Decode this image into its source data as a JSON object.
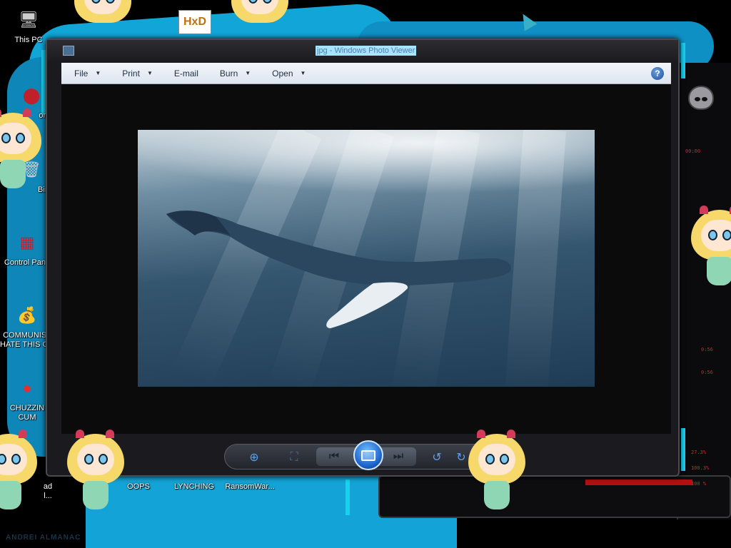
{
  "window": {
    "title": "jpg - Windows Photo Viewer",
    "menu": [
      {
        "label": "File",
        "has_caret": true
      },
      {
        "label": "Print",
        "has_caret": true
      },
      {
        "label": "E-mail",
        "has_caret": false
      },
      {
        "label": "Burn",
        "has_caret": true
      },
      {
        "label": "Open",
        "has_caret": true
      }
    ],
    "help_label": "?",
    "image": {
      "subject_icon": "photo-icon"
    },
    "toolbar": {
      "zoom": "zoom-icon",
      "actual_size": "actual-size-icon",
      "previous": "previous-icon",
      "slideshow": "slideshow-icon",
      "next": "next-icon",
      "rotate_ccw": "rotate-counterclockwise-icon",
      "rotate_cw": "rotate-clockwise-icon"
    }
  },
  "desktop": {
    "icons": [
      {
        "label": "This PC",
        "glyph": "🖥"
      },
      {
        "label": "ork",
        "glyph": "⬤"
      },
      {
        "label": "Bin",
        "glyph": "🗑"
      },
      {
        "label": "Control Pane",
        "glyph": "▦"
      },
      {
        "label": "COMMUNIST\nHATE THIS G...",
        "glyph": "💰"
      },
      {
        "label": "CHUZZIN\nCUM",
        "glyph": "●"
      },
      {
        "label": "ad\nl...",
        "glyph": ""
      },
      {
        "label": "OOPS",
        "glyph": ""
      },
      {
        "label": "LYNCHING",
        "glyph": ""
      },
      {
        "label": "RansomWar...",
        "glyph": ""
      }
    ],
    "top_icon_text": "HxD",
    "watermark": "ANDREI ALMANAC",
    "hud": {
      "values": [
        "00:00",
        "0:56",
        "0:56",
        "27.3%",
        "100.3%",
        "100 %"
      ],
      "colors": {
        "accent": "#1ad0f0",
        "hud_red": "#e02020",
        "wallpaper_blue": "#12a6d8"
      }
    }
  }
}
